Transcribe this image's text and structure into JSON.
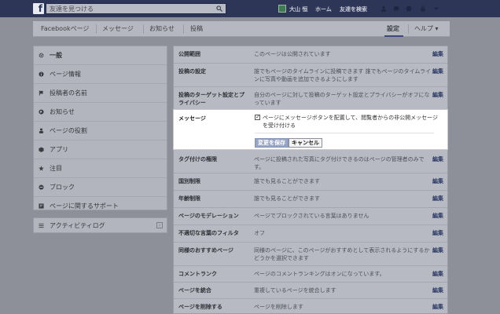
{
  "topbar": {
    "logo": "f",
    "search_value": "友達を見つける",
    "profile_name": "大山 恒",
    "home": "ホーム",
    "find_friends": "友達を検索"
  },
  "subnav": {
    "items": [
      "Facebookページ",
      "メッセージ",
      "お知らせ",
      "投稿"
    ],
    "settings": "設定",
    "help": "ヘルプ ▾"
  },
  "sidebar": {
    "items": [
      {
        "label": "一般",
        "icon": "gear-icon"
      },
      {
        "label": "ページ情報",
        "icon": "info-icon"
      },
      {
        "label": "投稿者の名前",
        "icon": "flag-icon"
      },
      {
        "label": "お知らせ",
        "icon": "globe-icon"
      },
      {
        "label": "ページの役割",
        "icon": "person-icon"
      },
      {
        "label": "アプリ",
        "icon": "cube-icon"
      },
      {
        "label": "注目",
        "icon": "star-icon"
      },
      {
        "label": "ブロック",
        "icon": "block-icon"
      },
      {
        "label": "ページに関するサポート",
        "icon": "help-box-icon"
      }
    ],
    "activity": "アクティビティログ"
  },
  "settings": {
    "edit_label": "編集",
    "rows": [
      {
        "name": "公開範囲",
        "value": "このページは公開されています"
      },
      {
        "name": "投稿の設定",
        "value": "誰でもページのタイムラインに投稿できます 誰でもページのタイムラインに写真や動画を追加できるようにします"
      },
      {
        "name": "投稿のターゲット設定とプライバシー",
        "value": "自分のページに対して投稿のターゲット設定とプライバシーがオフになっています"
      },
      {
        "name": "タグ付けの権限",
        "value": "ページに投稿された写真にタグ付けできるのはページの管理者のみです。"
      },
      {
        "name": "国別制限",
        "value": "誰でも見ることができます"
      },
      {
        "name": "年齢制限",
        "value": "誰でも見ることができます"
      },
      {
        "name": "ページのモデレーション",
        "value": "ページでブロックされている言葉はありません"
      },
      {
        "name": "不適切な言葉のフィルタ",
        "value": "オフ"
      },
      {
        "name": "同様のおすすめページ",
        "value": "同様のページに、このページがおすすめとして表示されるようにするかどうかを選択できます"
      },
      {
        "name": "コメントランク",
        "value": "ページのコメントランキングはオンになっています。"
      },
      {
        "name": "ページを統合",
        "value": "重複しているページを統合します"
      },
      {
        "name": "ページを削除する",
        "value": "ページを削除します"
      }
    ],
    "message": {
      "name": "メッセージ",
      "checkbox_label": "ページにメッセージボタンを配置して、閲覧者からの非公開メッセージを受け付ける",
      "checked": true,
      "save": "変更を保存",
      "cancel": "キャンセル"
    }
  }
}
